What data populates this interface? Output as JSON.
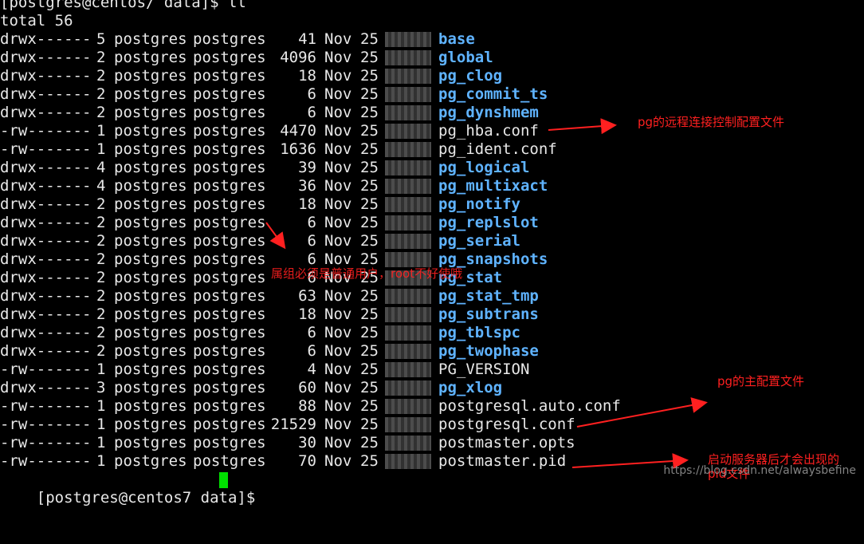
{
  "prompt_top": "[postgres@centos/ data]$ ll",
  "total": "total 56",
  "rows": [
    {
      "perm": "drwx------",
      "links": "5",
      "owner": "postgres",
      "group": "postgres",
      "size": "41",
      "month": "Nov",
      "day": "25",
      "name": "base",
      "dir": true
    },
    {
      "perm": "drwx------",
      "links": "2",
      "owner": "postgres",
      "group": "postgres",
      "size": "4096",
      "month": "Nov",
      "day": "25",
      "name": "global",
      "dir": true
    },
    {
      "perm": "drwx------",
      "links": "2",
      "owner": "postgres",
      "group": "postgres",
      "size": "18",
      "month": "Nov",
      "day": "25",
      "name": "pg_clog",
      "dir": true
    },
    {
      "perm": "drwx------",
      "links": "2",
      "owner": "postgres",
      "group": "postgres",
      "size": "6",
      "month": "Nov",
      "day": "25",
      "name": "pg_commit_ts",
      "dir": true
    },
    {
      "perm": "drwx------",
      "links": "2",
      "owner": "postgres",
      "group": "postgres",
      "size": "6",
      "month": "Nov",
      "day": "25",
      "name": "pg_dynshmem",
      "dir": true
    },
    {
      "perm": "-rw-------",
      "links": "1",
      "owner": "postgres",
      "group": "postgres",
      "size": "4470",
      "month": "Nov",
      "day": "25",
      "name": "pg_hba.conf",
      "dir": false
    },
    {
      "perm": "-rw-------",
      "links": "1",
      "owner": "postgres",
      "group": "postgres",
      "size": "1636",
      "month": "Nov",
      "day": "25",
      "name": "pg_ident.conf",
      "dir": false
    },
    {
      "perm": "drwx------",
      "links": "4",
      "owner": "postgres",
      "group": "postgres",
      "size": "39",
      "month": "Nov",
      "day": "25",
      "name": "pg_logical",
      "dir": true
    },
    {
      "perm": "drwx------",
      "links": "4",
      "owner": "postgres",
      "group": "postgres",
      "size": "36",
      "month": "Nov",
      "day": "25",
      "name": "pg_multixact",
      "dir": true
    },
    {
      "perm": "drwx------",
      "links": "2",
      "owner": "postgres",
      "group": "postgres",
      "size": "18",
      "month": "Nov",
      "day": "25",
      "name": "pg_notify",
      "dir": true
    },
    {
      "perm": "drwx------",
      "links": "2",
      "owner": "postgres",
      "group": "postgres",
      "size": "6",
      "month": "Nov",
      "day": "25",
      "name": "pg_replslot",
      "dir": true
    },
    {
      "perm": "drwx------",
      "links": "2",
      "owner": "postgres",
      "group": "postgres",
      "size": "6",
      "month": "Nov",
      "day": "25",
      "name": "pg_serial",
      "dir": true
    },
    {
      "perm": "drwx------",
      "links": "2",
      "owner": "postgres",
      "group": "postgres",
      "size": "6",
      "month": "Nov",
      "day": "25",
      "name": "pg_snapshots",
      "dir": true
    },
    {
      "perm": "drwx------",
      "links": "2",
      "owner": "postgres",
      "group": "postgres",
      "size": "6",
      "month": "Nov",
      "day": "25",
      "name": "pg_stat",
      "dir": true
    },
    {
      "perm": "drwx------",
      "links": "2",
      "owner": "postgres",
      "group": "postgres",
      "size": "63",
      "month": "Nov",
      "day": "25",
      "name": "pg_stat_tmp",
      "dir": true
    },
    {
      "perm": "drwx------",
      "links": "2",
      "owner": "postgres",
      "group": "postgres",
      "size": "18",
      "month": "Nov",
      "day": "25",
      "name": "pg_subtrans",
      "dir": true
    },
    {
      "perm": "drwx------",
      "links": "2",
      "owner": "postgres",
      "group": "postgres",
      "size": "6",
      "month": "Nov",
      "day": "25",
      "name": "pg_tblspc",
      "dir": true
    },
    {
      "perm": "drwx------",
      "links": "2",
      "owner": "postgres",
      "group": "postgres",
      "size": "6",
      "month": "Nov",
      "day": "25",
      "name": "pg_twophase",
      "dir": true
    },
    {
      "perm": "-rw-------",
      "links": "1",
      "owner": "postgres",
      "group": "postgres",
      "size": "4",
      "month": "Nov",
      "day": "25",
      "name": "PG_VERSION",
      "dir": false
    },
    {
      "perm": "drwx------",
      "links": "3",
      "owner": "postgres",
      "group": "postgres",
      "size": "60",
      "month": "Nov",
      "day": "25",
      "name": "pg_xlog",
      "dir": true
    },
    {
      "perm": "-rw-------",
      "links": "1",
      "owner": "postgres",
      "group": "postgres",
      "size": "88",
      "month": "Nov",
      "day": "25",
      "name": "postgresql.auto.conf",
      "dir": false
    },
    {
      "perm": "-rw-------",
      "links": "1",
      "owner": "postgres",
      "group": "postgres",
      "size": "21529",
      "month": "Nov",
      "day": "25",
      "name": "postgresql.conf",
      "dir": false
    },
    {
      "perm": "-rw-------",
      "links": "1",
      "owner": "postgres",
      "group": "postgres",
      "size": "30",
      "month": "Nov",
      "day": "25",
      "name": "postmaster.opts",
      "dir": false
    },
    {
      "perm": "-rw-------",
      "links": "1",
      "owner": "postgres",
      "group": "postgres",
      "size": "70",
      "month": "Nov",
      "day": "25",
      "name": "postmaster.pid",
      "dir": false
    }
  ],
  "prompt_bottom": "[postgres@centos7 data]$ ",
  "annotations": {
    "hba": "pg的远程连接控制配置文件",
    "group_note": "属组必须是普通用户，root不好使哦",
    "main_conf": "pg的主配置文件",
    "pid_note": "启动服务器后才会出现的pid文件"
  },
  "watermark": "https://blog.csdn.net/alwaysbefine",
  "colors": {
    "background": "#000000",
    "text": "#e8e8e8",
    "directory": "#5fb3ff",
    "annotation": "#ff2020",
    "cursor": "#00e000"
  }
}
